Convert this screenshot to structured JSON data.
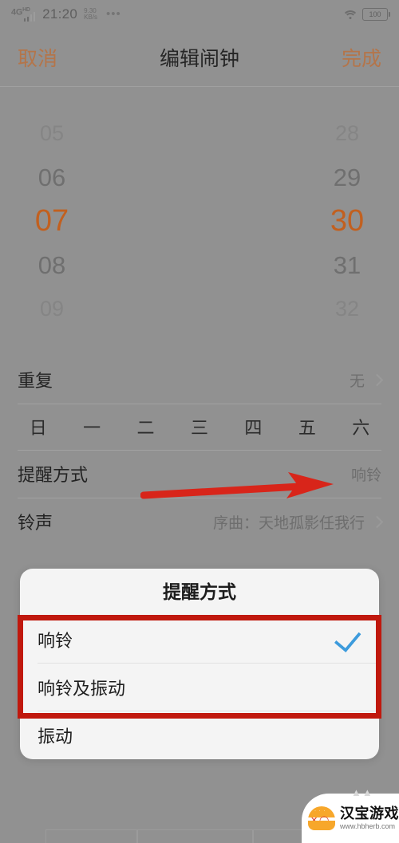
{
  "status_bar": {
    "network_type": "4G",
    "network_type_sup": "HD",
    "time": "21:20",
    "speed_value": "9.30",
    "speed_unit": "KB/s",
    "overflow_dots": "•••",
    "wifi_icon": "wifi-icon",
    "battery_level": "100"
  },
  "header": {
    "cancel_label": "取消",
    "title": "编辑闹钟",
    "done_label": "完成"
  },
  "time_picker": {
    "hours": [
      "05",
      "06",
      "07",
      "08",
      "09"
    ],
    "minutes": [
      "28",
      "29",
      "30",
      "31",
      "32"
    ],
    "selected_hour": "07",
    "selected_minute": "30",
    "selected_color": "#c2601f"
  },
  "rows": {
    "repeat": {
      "label": "重复",
      "value": "无"
    },
    "weekdays": [
      "日",
      "一",
      "二",
      "三",
      "四",
      "五",
      "六"
    ],
    "remind": {
      "label": "提醒方式",
      "value": "响铃"
    },
    "ringtone": {
      "label": "铃声",
      "value": "序曲：天地孤影任我行"
    }
  },
  "annotations": {
    "arrow_color": "#d8251a",
    "box_color": "#c0180d"
  },
  "dialog": {
    "title": "提醒方式",
    "options": [
      {
        "label": "响铃",
        "checked": true
      },
      {
        "label": "响铃及振动",
        "checked": false
      },
      {
        "label": "振动",
        "checked": false
      }
    ],
    "check_color": "#3d9bdc"
  },
  "watermark": {
    "name": "汉宝游戏",
    "url": "www.hbherb.com"
  }
}
